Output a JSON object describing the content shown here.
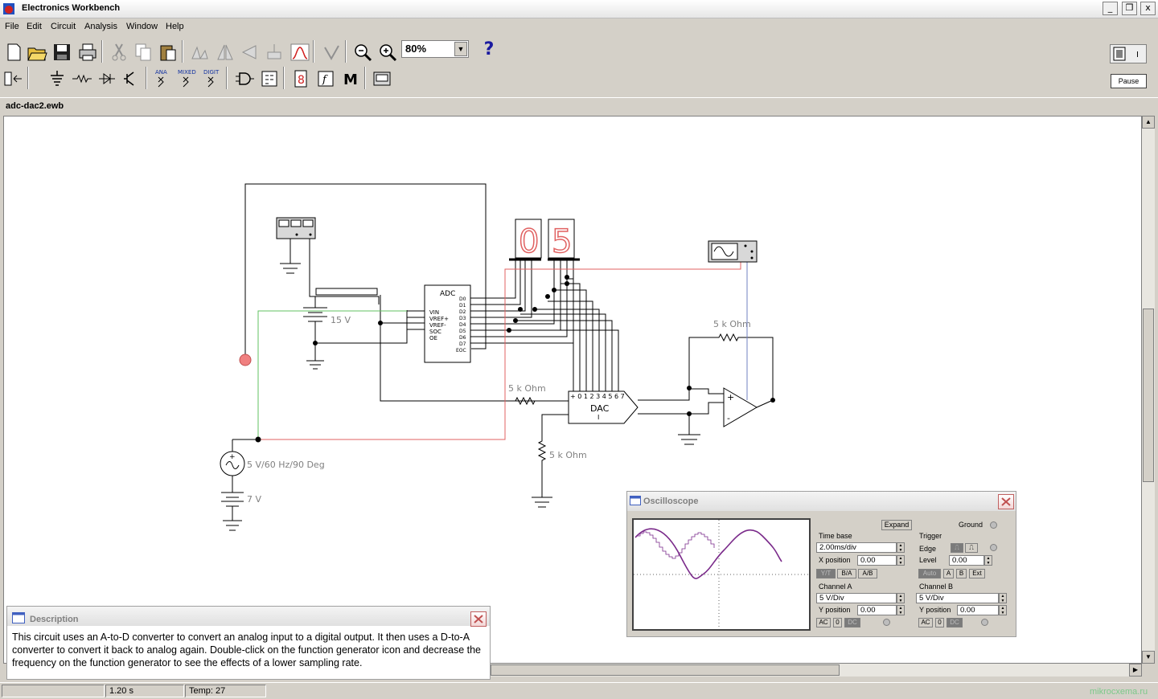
{
  "window": {
    "title": "Electronics Workbench",
    "buttons": [
      "_",
      "❐",
      "x"
    ]
  },
  "menu": [
    "File",
    "Edit",
    "Circuit",
    "Analysis",
    "Window",
    "Help"
  ],
  "toolbar": {
    "zoom_value": "80%",
    "help_label": "?",
    "pause_label": "Pause",
    "parts_labels": {
      "analog": "ANA",
      "mixed": "MIXED",
      "digital": "DIGIT",
      "measure": "M"
    }
  },
  "document": {
    "title": "adc-dac2.ewb"
  },
  "circuit": {
    "labels": {
      "adc": "ADC",
      "adc_inputs": [
        "VIN",
        "VREF+",
        "VREF-",
        "SOC",
        "OE"
      ],
      "adc_outputs": [
        "D0",
        "D1",
        "D2",
        "D3",
        "D4",
        "D5",
        "D6",
        "D7",
        "EOC"
      ],
      "dac": "DAC",
      "dac_i": "I",
      "dac_pins": "+ 0 1 2 3 4 5 6 7",
      "battery_15v": "15 V",
      "battery_7v": "7 V",
      "source": "5 V/60 Hz/90 Deg",
      "r1": "5 k Ohm",
      "r2": "5 k Ohm",
      "r3": "5 k Ohm",
      "opamp_plus": "+",
      "opamp_minus": "-",
      "display_left": "0",
      "display_right": "5"
    }
  },
  "description": {
    "title": "Description",
    "text": "This circuit uses an A-to-D converter to convert an analog input to a digital output. It then uses a D-to-A converter to convert it back to analog again. Double-click on the function generator icon and decrease the frequency on the function generator to see the effects of  a lower sampling rate."
  },
  "oscilloscope": {
    "title": "Oscilloscope",
    "expand": "Expand",
    "ground": "Ground",
    "time_base": {
      "label": "Time base",
      "value": "2.00ms/div",
      "xpos_label": "X position",
      "xpos_value": "0.00",
      "modes": [
        "Y/T",
        "B/A",
        "A/B"
      ]
    },
    "trigger": {
      "label": "Trigger",
      "edge_label": "Edge",
      "level_label": "Level",
      "level_value": "0.00",
      "sources": [
        "Auto",
        "A",
        "B",
        "Ext"
      ]
    },
    "channel_a": {
      "label": "Channel A",
      "value": "5  V/Div",
      "ypos_label": "Y position",
      "ypos_value": "0.00",
      "coupling": [
        "AC",
        "0",
        "DC"
      ]
    },
    "channel_b": {
      "label": "Channel B",
      "value": "5  V/Div",
      "ypos_label": "Y position",
      "ypos_value": "0.00",
      "coupling": [
        "AC",
        "0",
        "DC"
      ]
    }
  },
  "status": {
    "time": "1.20 s",
    "temp": "Temp:  27"
  },
  "watermark": "mikrocxema.ru",
  "colors": {
    "accent_red": "#e06060",
    "wire": "#000000",
    "green_wire": "#60c060",
    "trace": "#7a2a8a"
  }
}
